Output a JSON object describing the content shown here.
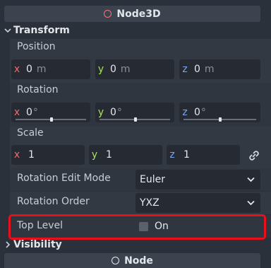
{
  "header": {
    "title": "Node3D",
    "icon": "node3d-icon"
  },
  "transform": {
    "title": "Transform",
    "position": {
      "label": "Position",
      "x": "0",
      "y": "0",
      "z": "0",
      "unit": "m"
    },
    "rotation": {
      "label": "Rotation",
      "x": "0",
      "y": "0",
      "z": "0",
      "unit": "°"
    },
    "scale": {
      "label": "Scale",
      "x": "1",
      "y": "1",
      "z": "1",
      "icon": "link-icon"
    },
    "axes": {
      "x": "x",
      "y": "y",
      "z": "z"
    },
    "rotation_edit_mode": {
      "label": "Rotation Edit Mode",
      "value": "Euler"
    },
    "rotation_order": {
      "label": "Rotation Order",
      "value": "YXZ"
    },
    "top_level": {
      "label": "Top Level",
      "checkbox_label": "On",
      "checked": false
    }
  },
  "visibility": {
    "title": "Visibility"
  },
  "footer": {
    "title": "Node",
    "icon": "node-icon"
  },
  "colors": {
    "axis_x": "#f36b6b",
    "axis_y": "#a8e35a",
    "axis_z": "#7aa6f2",
    "highlight": "#e8101a"
  }
}
